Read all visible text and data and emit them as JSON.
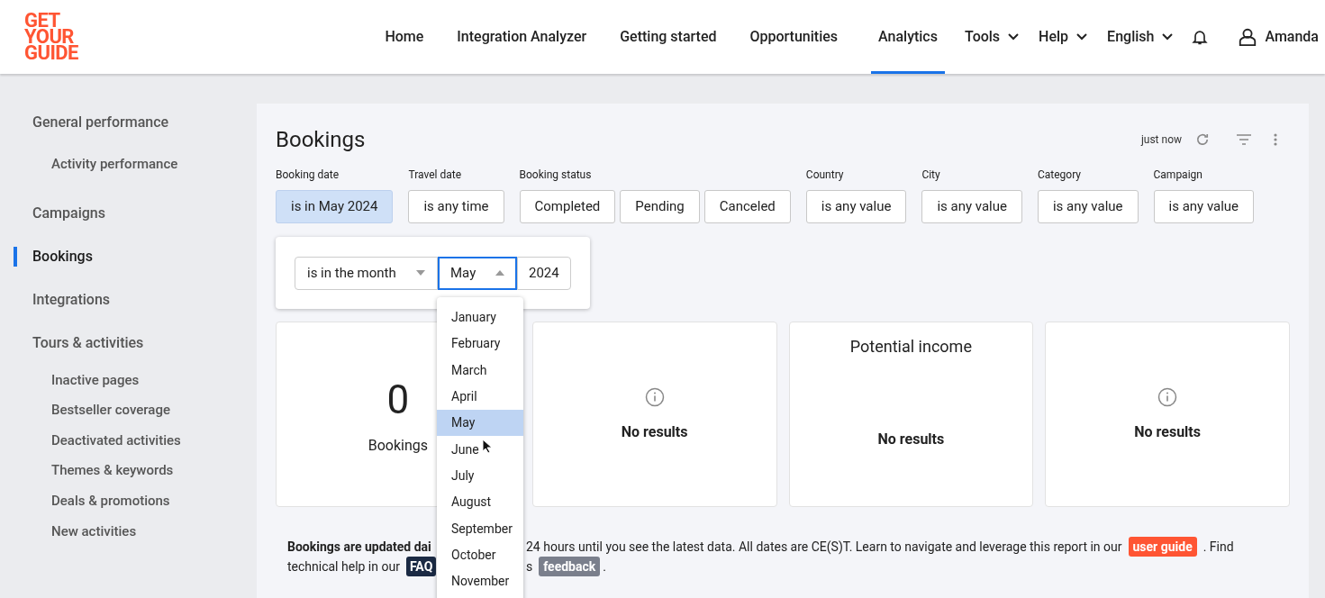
{
  "logo": [
    "GET",
    "YOUR",
    "GUIDE"
  ],
  "nav": [
    {
      "label": "Home",
      "selected": false,
      "dropdown": false
    },
    {
      "label": "Integration Analyzer",
      "selected": false,
      "dropdown": false
    },
    {
      "label": "Getting started",
      "selected": false,
      "dropdown": false
    },
    {
      "label": "Opportunities",
      "selected": false,
      "dropdown": false
    },
    {
      "label": "Analytics",
      "selected": true,
      "dropdown": false
    },
    {
      "label": "Tools",
      "selected": false,
      "dropdown": true
    },
    {
      "label": "Help",
      "selected": false,
      "dropdown": true
    },
    {
      "label": "English",
      "selected": false,
      "dropdown": true
    }
  ],
  "user": {
    "name": "Amanda"
  },
  "sidebar": {
    "items": [
      {
        "label": "General performance",
        "selected": false,
        "children": [
          {
            "label": "Activity performance",
            "selected": false
          }
        ]
      },
      {
        "label": "Campaigns",
        "selected": false
      },
      {
        "label": "Bookings",
        "selected": true
      },
      {
        "label": "Integrations",
        "selected": false
      },
      {
        "label": "Tours & activities",
        "selected": false,
        "children": [
          {
            "label": "Inactive pages",
            "selected": false
          },
          {
            "label": "Bestseller coverage",
            "selected": false
          },
          {
            "label": "Deactivated activities",
            "selected": false
          },
          {
            "label": "Themes & keywords",
            "selected": false
          },
          {
            "label": "Deals & promotions",
            "selected": false
          },
          {
            "label": "New activities",
            "selected": false
          }
        ]
      }
    ]
  },
  "report": {
    "title": "Bookings",
    "updated": "just now"
  },
  "filters": [
    {
      "label": "Booking date",
      "options": [
        {
          "text": "is in May 2024",
          "selected": true
        }
      ]
    },
    {
      "label": "Travel date",
      "options": [
        {
          "text": "is any time",
          "selected": false
        }
      ]
    },
    {
      "label": "Booking status",
      "options": [
        {
          "text": "Completed",
          "selected": false
        },
        {
          "text": "Pending",
          "selected": false
        },
        {
          "text": "Canceled",
          "selected": false
        }
      ]
    },
    {
      "label": "Country",
      "options": [
        {
          "text": "is any value",
          "selected": false
        }
      ]
    },
    {
      "label": "City",
      "options": [
        {
          "text": "is any value",
          "selected": false
        }
      ]
    },
    {
      "label": "Category",
      "options": [
        {
          "text": "is any value",
          "selected": false
        }
      ]
    },
    {
      "label": "Campaign",
      "options": [
        {
          "text": "is any value",
          "selected": false
        }
      ]
    }
  ],
  "date_popover": {
    "operator": "is in the month",
    "month": "May",
    "year": "2024",
    "month_options": [
      {
        "label": "January",
        "selected": false
      },
      {
        "label": "February",
        "selected": false
      },
      {
        "label": "March",
        "selected": false
      },
      {
        "label": "April",
        "selected": false
      },
      {
        "label": "May",
        "selected": true
      },
      {
        "label": "June",
        "selected": false
      },
      {
        "label": "July",
        "selected": false
      },
      {
        "label": "August",
        "selected": false
      },
      {
        "label": "September",
        "selected": false
      },
      {
        "label": "October",
        "selected": false
      },
      {
        "label": "November",
        "selected": false
      }
    ]
  },
  "cards": [
    {
      "kind": "metric",
      "value": "0",
      "caption": "Bookings"
    },
    {
      "kind": "info",
      "caption": "No results"
    },
    {
      "kind": "titled",
      "title": "Potential income",
      "caption": "No results"
    },
    {
      "kind": "info",
      "caption": "No results"
    }
  ],
  "footer": [
    {
      "left": [
        {
          "kind": "bold",
          "text": "Bookings are updated dai"
        }
      ],
      "right": [
        {
          "kind": "text",
          "text": "24 hours until you see the latest data. All dates are CE(S)T. Learn to navigate and leverage this report in our"
        },
        {
          "kind": "orange",
          "text": "user guide"
        },
        {
          "kind": "text",
          "text": ". Find"
        }
      ]
    },
    {
      "left": [
        {
          "kind": "text",
          "text": "technical help in our"
        },
        {
          "kind": "navy",
          "text": "FAQ"
        }
      ],
      "right": [
        {
          "kind": "text",
          "text": "s"
        },
        {
          "kind": "gray",
          "text": "feedback"
        },
        {
          "kind": "text",
          "text": "."
        }
      ]
    }
  ]
}
